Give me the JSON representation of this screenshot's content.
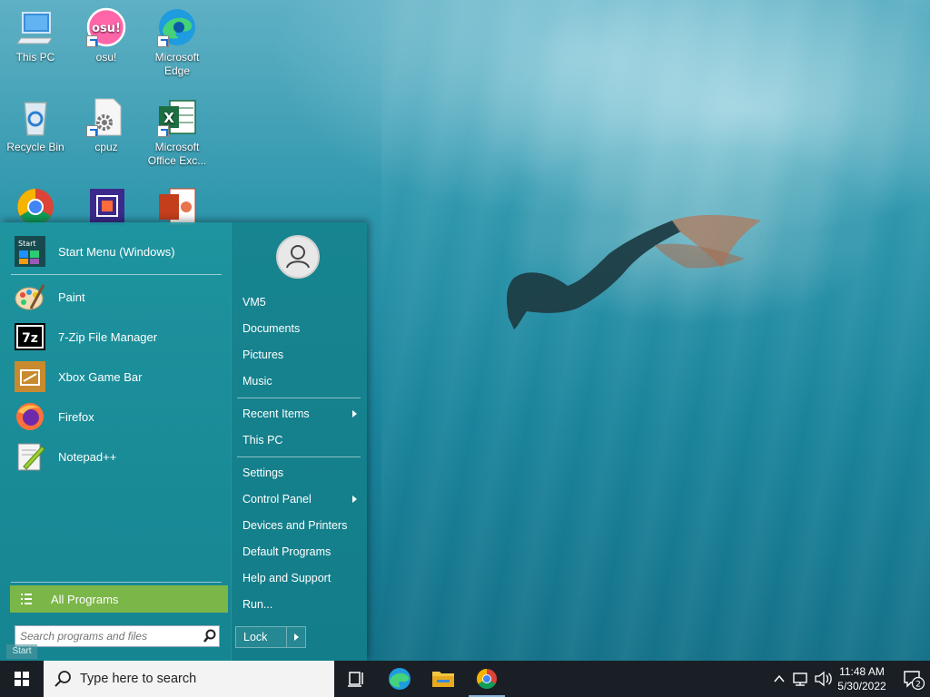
{
  "desktop": {
    "icons": [
      {
        "label": "This PC"
      },
      {
        "label": "osu!"
      },
      {
        "label": "Microsoft Edge"
      },
      {
        "label": "Recycle Bin"
      },
      {
        "label": "cpuz"
      },
      {
        "label": "Microsoft Office Exc..."
      }
    ],
    "osu_text": "osu!",
    "excel_letter": "X"
  },
  "start_menu": {
    "pinned": [
      {
        "label": "Start Menu (Windows)",
        "icon": "start-menu-icon",
        "icon_text": "Start"
      },
      {
        "label": "Paint",
        "icon": "paint-palette-icon"
      },
      {
        "label": "7-Zip File Manager",
        "icon": "seven-zip-icon",
        "icon_text": "7z"
      },
      {
        "label": "Xbox Game Bar",
        "icon": "xbox-game-bar-icon"
      },
      {
        "label": "Firefox",
        "icon": "firefox-icon"
      },
      {
        "label": "Notepad++",
        "icon": "notepad-plus-plus-icon"
      }
    ],
    "all_programs": "All Programs",
    "search_placeholder": "Search programs and files",
    "start_tooltip": "Start",
    "right": {
      "user": "VM5",
      "documents": "Documents",
      "pictures": "Pictures",
      "music": "Music",
      "recent_items": "Recent Items",
      "this_pc": "This PC",
      "settings": "Settings",
      "control_panel": "Control Panel",
      "devices_printers": "Devices and Printers",
      "default_programs": "Default Programs",
      "help_support": "Help and Support",
      "run": "Run...",
      "lock": "Lock"
    }
  },
  "taskbar": {
    "search_placeholder": "Type here to search",
    "time": "11:48 AM",
    "date": "5/30/2022",
    "notification_count": "2"
  },
  "colors": {
    "menu_bg": "#1c949e",
    "all_programs": "#7ab648",
    "taskbar": "#1a1f26"
  }
}
